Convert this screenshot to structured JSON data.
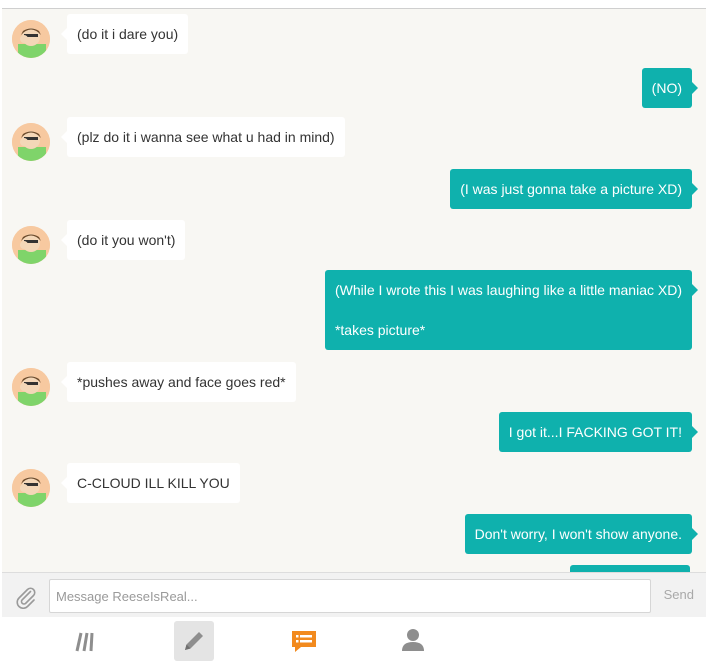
{
  "messages": [
    {
      "dir": "in",
      "text": "(do it i dare you)"
    },
    {
      "dir": "out",
      "text": "(NO)"
    },
    {
      "dir": "in",
      "text": "(plz do it i wanna see what u had in mind)"
    },
    {
      "dir": "out",
      "text": "(I was just gonna take a picture XD)"
    },
    {
      "dir": "in",
      "text": "(do it you won't)"
    },
    {
      "dir": "out",
      "text": "(While I wrote this I was laughing like a little maniac XD)",
      "text2": "*takes picture*"
    },
    {
      "dir": "in",
      "text": "*pushes away and face goes red*"
    },
    {
      "dir": "out",
      "text": "I got it...I FACKING GOT IT!"
    },
    {
      "dir": "in",
      "text": "C-CLOUD ILL KILL YOU"
    },
    {
      "dir": "out",
      "text": "Don't worry, I won't show anyone."
    }
  ],
  "composer": {
    "placeholder": "Message ReeseIsReal...",
    "send_label": "Send",
    "attach_icon": "paperclip-icon"
  },
  "nav": {
    "items": [
      {
        "icon": "feed-icon"
      },
      {
        "icon": "pencil-icon",
        "selected": true
      },
      {
        "icon": "chat-icon",
        "active": true
      },
      {
        "icon": "profile-icon"
      }
    ]
  },
  "colors": {
    "outgoing_bubble": "#0fb1ad",
    "incoming_bubble": "#ffffff",
    "chat_background": "#f8f7f3",
    "nav_active": "#f28a1e",
    "nav_inactive": "#8e8e8e"
  }
}
